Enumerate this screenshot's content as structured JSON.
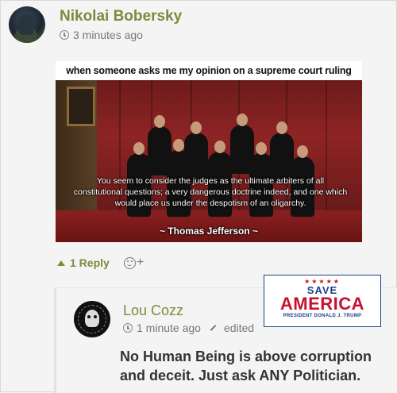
{
  "comment": {
    "author": "Nikolai Bobersky",
    "timestamp": "3 minutes ago",
    "image": {
      "caption": "when someone asks me my opinion on a supreme court ruling",
      "quote": "You seem to consider the judges as the ultimate arbiters of all constitutional questions; a very dangerous doctrine indeed, and one which would place us under the despotism of an oligarchy.",
      "attribution": "~ Thomas Jefferson ~"
    },
    "reply_toggle": "1 Reply",
    "react_plus": "+"
  },
  "reply": {
    "author": "Lou Cozz",
    "timestamp": "1 minute ago",
    "edited": "edited",
    "body": "No Human Being is above corruption and deceit. Just ask ANY Politician."
  },
  "badge": {
    "stars": "★★★★★",
    "save": "SAVE",
    "america": "AMERICA",
    "subtitle": "PRESIDENT DONALD J. TRUMP"
  }
}
